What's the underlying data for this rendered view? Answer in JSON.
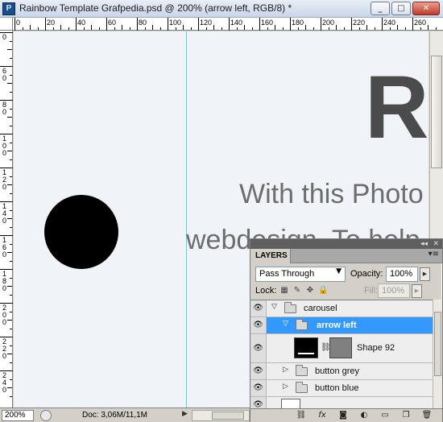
{
  "window": {
    "app_icon": "P",
    "title": "Rainbow Template Grafpedia.psd @ 200% (arrow left, RGB/8) *",
    "minimize": "_",
    "maximize": "□",
    "close": "✕"
  },
  "rulers": {
    "top_labels": [
      "0",
      "20",
      "40",
      "60",
      "80",
      "100",
      "120",
      "140",
      "160",
      "180",
      "200",
      "220",
      "240",
      "260"
    ],
    "left_labels": [
      "0",
      "6 0",
      "8 0",
      "1 0 0",
      "1 2 0",
      "1 4 0",
      "1 6 0",
      "1 8 0",
      "2 0 0",
      "2 2 0",
      "2 4 0"
    ]
  },
  "canvas": {
    "heading_letter": "R",
    "line1": "With this Photo",
    "line2": "webdesign. To help"
  },
  "status": {
    "zoom": "200%",
    "doc_info": "Doc: 3,06M/11,1M",
    "arrow": "▶"
  },
  "layers_panel": {
    "tab_label": "LAYERS",
    "collapse_glyph": "◂◂",
    "close_glyph": "✕",
    "menu_glyph": "▾≡",
    "blend_mode": "Pass Through",
    "opacity_label": "Opacity:",
    "opacity_value": "100%",
    "lock_label": "Lock:",
    "fill_label": "Fill:",
    "fill_value": "100%",
    "layers": [
      {
        "name": "carousel",
        "expanded": true,
        "selected": false
      },
      {
        "name": "arrow left",
        "expanded": true,
        "selected": true
      },
      {
        "name": "Shape 92",
        "selected": false
      },
      {
        "name": "button grey",
        "expanded": false,
        "selected": false
      },
      {
        "name": "button blue",
        "expanded": false,
        "selected": false
      }
    ],
    "footer_icons": [
      "link-icon",
      "fx-icon",
      "mask-icon",
      "adjustment-icon",
      "group-icon",
      "new-layer-icon",
      "trash-icon"
    ]
  },
  "colors": {
    "selection_blue": "#3399ff",
    "guide_cyan": "#4fd9e6",
    "canvas_bg": "#f0f4f8"
  }
}
